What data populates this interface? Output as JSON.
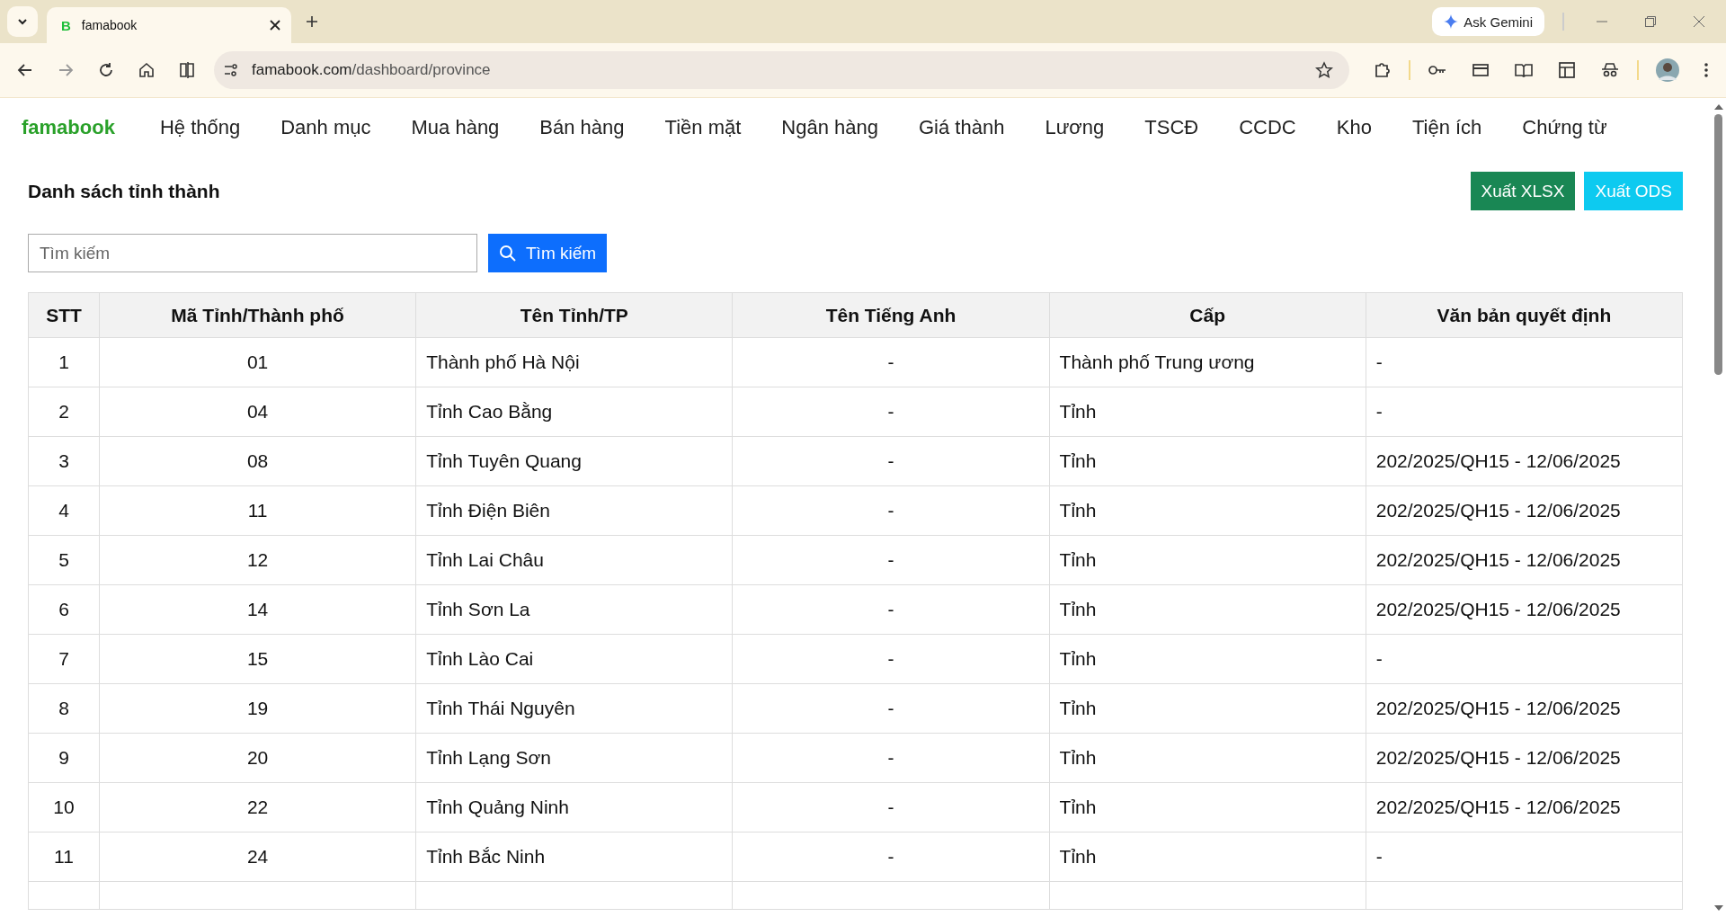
{
  "browser": {
    "tab_title": "famabook",
    "tab_favicon": "B",
    "url_host": "famabook.com",
    "url_path": "/dashboard/province",
    "gemini": "Ask Gemini"
  },
  "nav": {
    "logo": "famabook",
    "items": [
      "Hệ thống",
      "Danh mục",
      "Mua hàng",
      "Bán hàng",
      "Tiền mặt",
      "Ngân hàng",
      "Giá thành",
      "Lương",
      "TSCĐ",
      "CCDC",
      "Kho",
      "Tiện ích",
      "Chứng từ"
    ]
  },
  "page": {
    "title": "Danh sách tỉnh thành",
    "export_buttons": [
      {
        "label": "Xuất XLSX",
        "kind": "xlsx"
      },
      {
        "label": "Xuất ODS",
        "kind": "ods"
      }
    ],
    "search": {
      "placeholder": "Tìm kiếm",
      "button": "Tìm kiếm"
    }
  },
  "table": {
    "columns": [
      "STT",
      "Mã Tỉnh/Thành phố",
      "Tên Tỉnh/TP",
      "Tên Tiếng Anh",
      "Cấp",
      "Văn bản quyết định"
    ],
    "rows": [
      [
        "1",
        "01",
        "Thành phố Hà Nội",
        "-",
        "Thành phố Trung ương",
        "-"
      ],
      [
        "2",
        "04",
        "Tỉnh Cao Bằng",
        "-",
        "Tỉnh",
        "-"
      ],
      [
        "3",
        "08",
        "Tỉnh Tuyên Quang",
        "-",
        "Tỉnh",
        "202/2025/QH15 - 12/06/2025"
      ],
      [
        "4",
        "11",
        "Tỉnh Điện Biên",
        "-",
        "Tỉnh",
        "202/2025/QH15 - 12/06/2025"
      ],
      [
        "5",
        "12",
        "Tỉnh Lai Châu",
        "-",
        "Tỉnh",
        "202/2025/QH15 - 12/06/2025"
      ],
      [
        "6",
        "14",
        "Tỉnh Sơn La",
        "-",
        "Tỉnh",
        "202/2025/QH15 - 12/06/2025"
      ],
      [
        "7",
        "15",
        "Tỉnh Lào Cai",
        "-",
        "Tỉnh",
        "-"
      ],
      [
        "8",
        "19",
        "Tỉnh Thái Nguyên",
        "-",
        "Tỉnh",
        "202/2025/QH15 - 12/06/2025"
      ],
      [
        "9",
        "20",
        "Tỉnh Lạng Sơn",
        "-",
        "Tỉnh",
        "202/2025/QH15 - 12/06/2025"
      ],
      [
        "10",
        "22",
        "Tỉnh Quảng Ninh",
        "-",
        "Tỉnh",
        "202/2025/QH15 - 12/06/2025"
      ],
      [
        "11",
        "24",
        "Tỉnh Bắc Ninh",
        "-",
        "Tỉnh",
        "-"
      ]
    ]
  }
}
